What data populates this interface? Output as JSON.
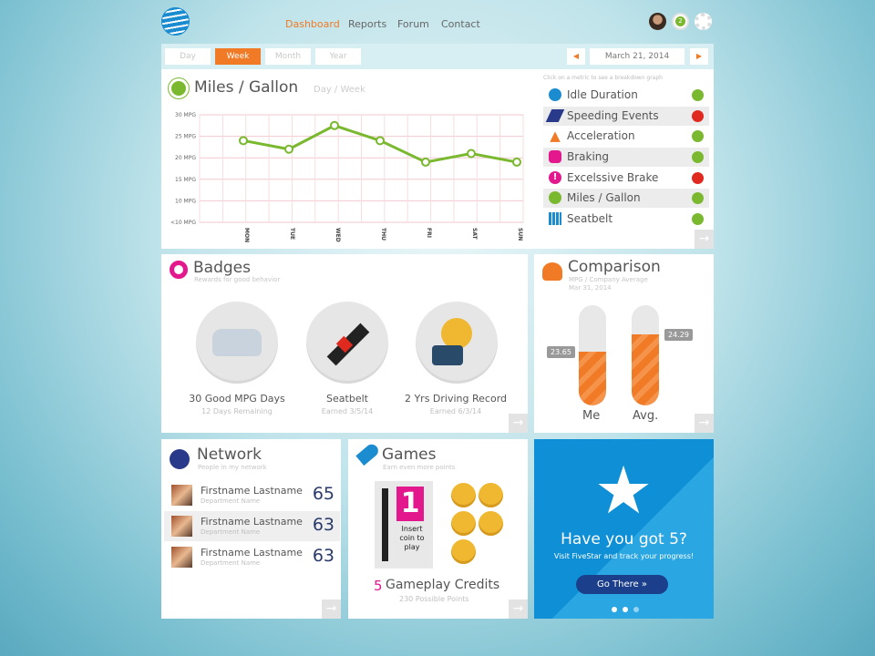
{
  "header": {
    "nav": [
      "Dashboard",
      "Reports",
      "Forum",
      "Contact"
    ],
    "active": "Dashboard",
    "notification_count": "2"
  },
  "tabs": {
    "items": [
      "Day",
      "Week",
      "Month",
      "Year"
    ],
    "active": "Week",
    "date": "March 21, 2014",
    "prev": "◀",
    "next": "▶"
  },
  "mpg": {
    "title": "Miles / Gallon",
    "subtitle": "Day / Week",
    "hint": "Click on a metric to see a breakdown graph"
  },
  "chart_data": {
    "type": "line",
    "title": "Miles / Gallon",
    "categories": [
      "MON",
      "TUE",
      "WED",
      "THU",
      "FRI",
      "SAT",
      "SUN"
    ],
    "y_tick_labels": [
      "<10 MPG",
      "10 MPG",
      "15 MPG",
      "20 MPG",
      "25 MPG",
      "30 MPG"
    ],
    "y_ticks": [
      5,
      10,
      15,
      20,
      25,
      30
    ],
    "ylim": [
      5,
      30
    ],
    "color": "#7ab830",
    "series": [
      {
        "values": [
          null,
          24,
          22,
          27.5,
          24,
          19,
          21,
          19
        ]
      }
    ]
  },
  "metrics": [
    {
      "label": "Idle Duration",
      "icon": "stopwatch-icon",
      "status": "#7ab830"
    },
    {
      "label": "Speeding Events",
      "icon": "speeding-icon",
      "status": "#e0291f"
    },
    {
      "label": "Acceleration",
      "icon": "arrow-up-icon",
      "status": "#7ab830"
    },
    {
      "label": "Braking",
      "icon": "stop-sign-icon",
      "status": "#7ab830"
    },
    {
      "label": "Excelssive Brake",
      "icon": "warning-icon",
      "status": "#e0291f"
    },
    {
      "label": "Miles / Gallon",
      "icon": "gauge-icon",
      "status": "#7ab830"
    },
    {
      "label": "Seatbelt",
      "icon": "seatbelt-icon",
      "status": "#7ab830"
    }
  ],
  "badges": {
    "title": "Badges",
    "subtitle": "Rewards for good behavior",
    "items": [
      {
        "label": "30 Good MPG Days",
        "sub": "12 Days Remaining"
      },
      {
        "label": "Seatbelt",
        "sub": "Earned 3/5/14"
      },
      {
        "label": "2 Yrs Driving Record",
        "sub": "Earned 6/3/14"
      }
    ]
  },
  "comparison": {
    "title": "Comparison",
    "subtitle": "MPG / Company Average",
    "date": "Mar 31, 2014",
    "me_label": "Me",
    "avg_label": "Avg.",
    "me_value": "23.65",
    "avg_value": "24.29",
    "me_fill": 0.54,
    "avg_fill": 0.71
  },
  "network": {
    "title": "Network",
    "subtitle": "People in my network",
    "people": [
      {
        "name": "Firstname Lastname",
        "dept": "Department Name",
        "score": "65"
      },
      {
        "name": "Firstname Lastname",
        "dept": "Department Name",
        "score": "63"
      },
      {
        "name": "Firstname Lastname",
        "dept": "Department Name",
        "score": "63"
      }
    ]
  },
  "games": {
    "title": "Games",
    "subtitle": "Earn even more points",
    "credits_num": "5",
    "credits_label": "Gameplay Credits",
    "points": "230 Possible Points",
    "slot_number": "1",
    "slot_text": "Insert coin to play"
  },
  "promo": {
    "title": "Have you got 5?",
    "text": "Visit FiveStar and track your progress!",
    "button": "Go There »"
  },
  "arrow": "→"
}
